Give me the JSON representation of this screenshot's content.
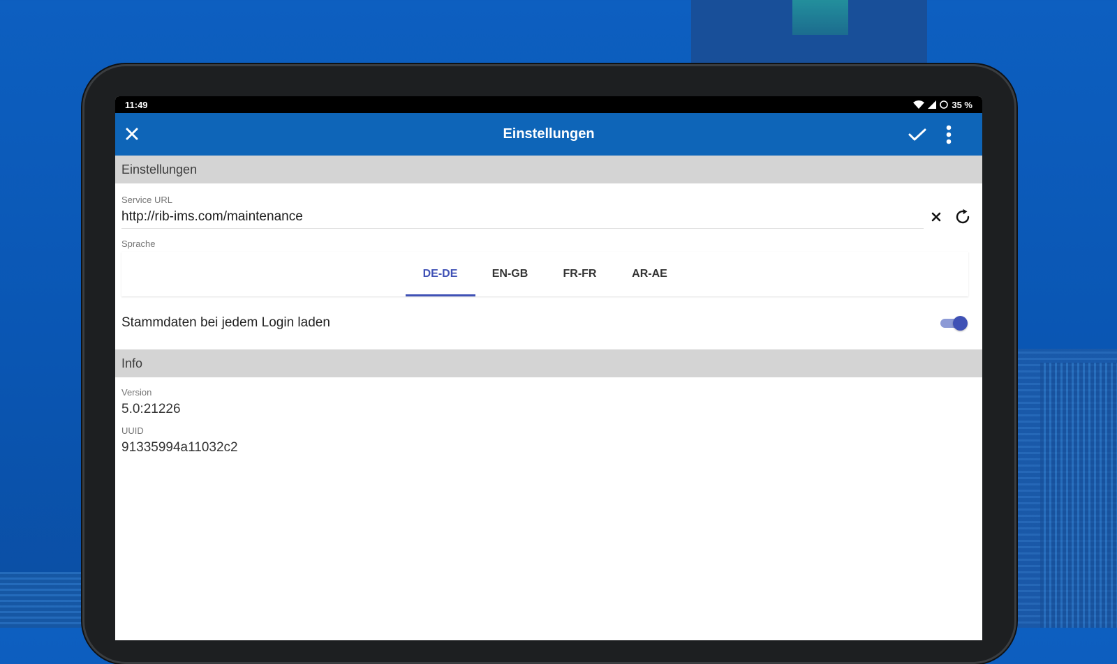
{
  "status_bar": {
    "time": "11:49",
    "battery": "35 %"
  },
  "app_bar": {
    "title": "Einstellungen"
  },
  "settings_section": {
    "header": "Einstellungen",
    "service_url": {
      "label": "Service URL",
      "value": "http://rib-ims.com/maintenance"
    },
    "language": {
      "label": "Sprache",
      "tabs": [
        "DE-DE",
        "EN-GB",
        "FR-FR",
        "AR-AE"
      ],
      "selected": "DE-DE"
    },
    "masterdata_toggle": {
      "label": "Stammdaten bei jedem Login laden",
      "on": true
    }
  },
  "info_section": {
    "header": "Info",
    "version": {
      "label": "Version",
      "value": "5.0:21226"
    },
    "uuid": {
      "label": "UUID",
      "value": "91335994a11032c2"
    }
  },
  "colors": {
    "app_bar": "#0e65b8",
    "accent": "#3f51b5",
    "section_header": "#d4d4d4",
    "background": "#0d5fc0"
  }
}
